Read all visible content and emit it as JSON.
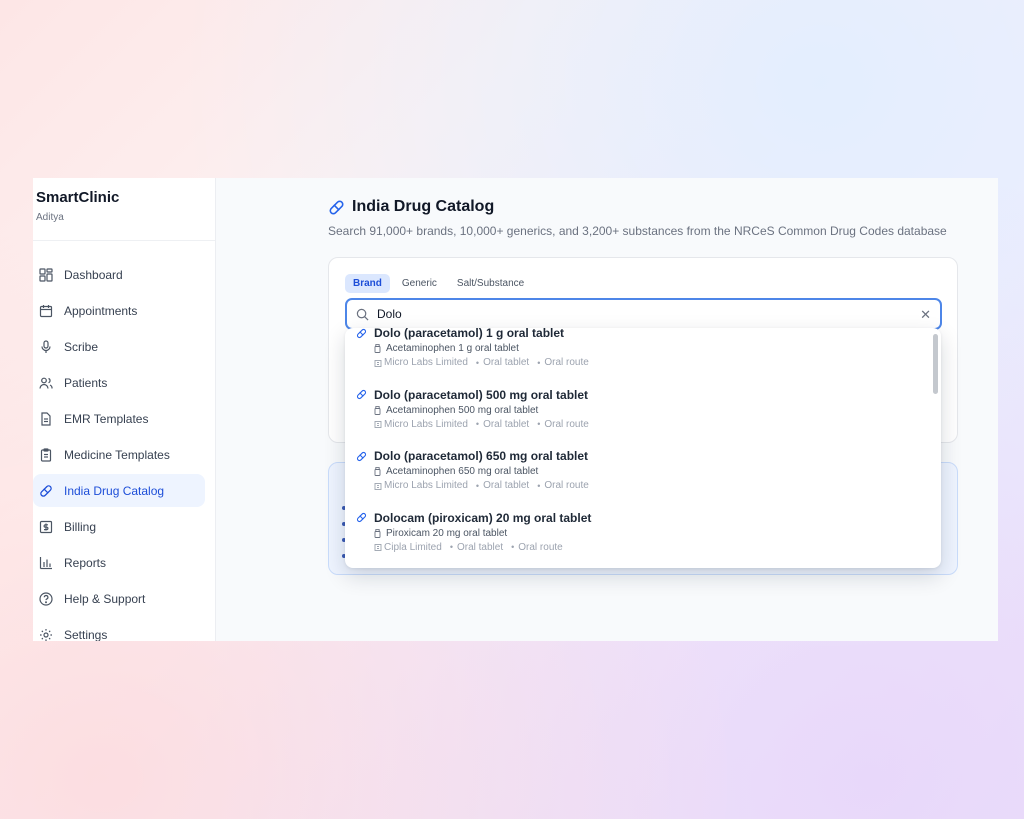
{
  "app": {
    "name": "SmartClinic",
    "user": "Aditya"
  },
  "sidebar": {
    "items": [
      {
        "label": "Dashboard",
        "icon": "dashboard-icon"
      },
      {
        "label": "Appointments",
        "icon": "calendar-icon"
      },
      {
        "label": "Scribe",
        "icon": "microphone-icon"
      },
      {
        "label": "Patients",
        "icon": "users-icon"
      },
      {
        "label": "EMR Templates",
        "icon": "document-icon"
      },
      {
        "label": "Medicine Templates",
        "icon": "clipboard-icon"
      },
      {
        "label": "India Drug Catalog",
        "icon": "pill-icon",
        "active": true
      },
      {
        "label": "Billing",
        "icon": "dollar-icon"
      },
      {
        "label": "Reports",
        "icon": "bar-chart-icon"
      },
      {
        "label": "Help & Support",
        "icon": "help-icon"
      },
      {
        "label": "Settings",
        "icon": "gear-icon"
      }
    ]
  },
  "page": {
    "title": "India Drug Catalog",
    "subtitle": "Search 91,000+ brands, 10,000+ generics, and 3,200+ substances from the NRCeS Common Drug Codes database"
  },
  "search": {
    "tabs": [
      "Brand",
      "Generic",
      "Salt/Substance"
    ],
    "active_tab": "Brand",
    "value": "Dolo",
    "clear_icon": "close-icon"
  },
  "results": [
    {
      "name": "Dolo (paracetamol) 1 g oral tablet",
      "generic": "Acetaminophen 1 g oral tablet",
      "manufacturer": "Micro Labs Limited",
      "form": "Oral tablet",
      "route": "Oral route"
    },
    {
      "name": "Dolo (paracetamol) 500 mg oral tablet",
      "generic": "Acetaminophen 500 mg oral tablet",
      "manufacturer": "Micro Labs Limited",
      "form": "Oral tablet",
      "route": "Oral route"
    },
    {
      "name": "Dolo (paracetamol) 650 mg oral tablet",
      "generic": "Acetaminophen 650 mg oral tablet",
      "manufacturer": "Micro Labs Limited",
      "form": "Oral tablet",
      "route": "Oral route"
    },
    {
      "name": "Dolocam (piroxicam) 20 mg oral tablet",
      "generic": "Piroxicam 20 mg oral tablet",
      "manufacturer": "Cipla Limited",
      "form": "Oral tablet",
      "route": "Oral route"
    }
  ],
  "colors": {
    "accent": "#4d86e8",
    "active_nav_bg": "#eef4ff",
    "active_text": "#1d4ed8"
  }
}
